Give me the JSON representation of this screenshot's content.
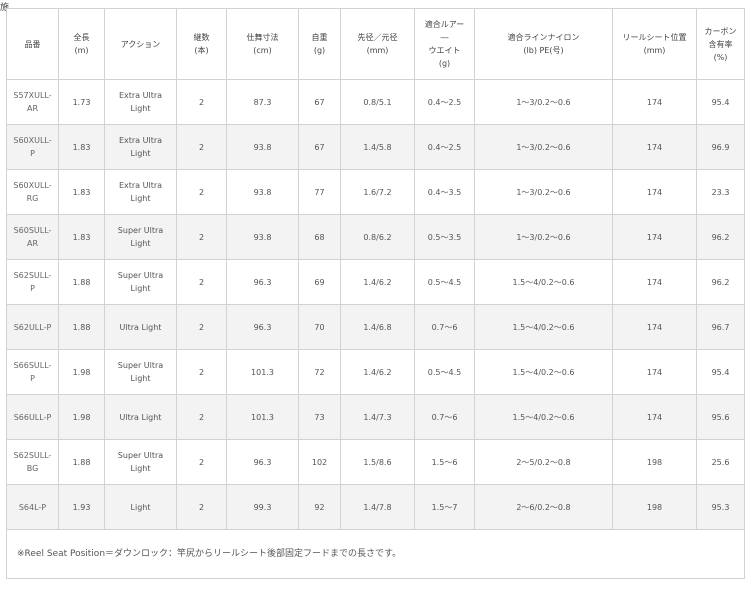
{
  "corner_mark": "施",
  "headers": [
    "品番\n",
    "全長\n(m)",
    "アクション",
    "継数\n(本)",
    "仕舞寸法\n(cm)",
    "自重\n(g)",
    "先径／元径\n(mm)",
    "適合ルアー\n―\nウエイト\n(g)",
    "適合ラインナイロン\n(lb) PE(号)",
    "リールシート位置\n(mm)",
    "カーボン\n含有率\n(%)"
  ],
  "rows": [
    {
      "model": "S57XULL-\nAR",
      "length": "1.73",
      "action": "Extra Ultra\nLight",
      "pieces": "2",
      "closed": "87.3",
      "weight": "67",
      "diameter": "0.8/5.1",
      "lure": "0.4〜2.5",
      "line": "1〜3/0.2〜0.6",
      "seat": "174",
      "carbon": "95.4"
    },
    {
      "model": "S60XULL-\nP",
      "length": "1.83",
      "action": "Extra Ultra\nLight",
      "pieces": "2",
      "closed": "93.8",
      "weight": "67",
      "diameter": "1.4/5.8",
      "lure": "0.4〜2.5",
      "line": "1〜3/0.2〜0.6",
      "seat": "174",
      "carbon": "96.9"
    },
    {
      "model": "S60XULL-\nRG",
      "length": "1.83",
      "action": "Extra Ultra\nLight",
      "pieces": "2",
      "closed": "93.8",
      "weight": "77",
      "diameter": "1.6/7.2",
      "lure": "0.4〜3.5",
      "line": "1〜3/0.2〜0.6",
      "seat": "174",
      "carbon": "23.3"
    },
    {
      "model": "S60SULL-\nAR",
      "length": "1.83",
      "action": "Super Ultra\nLight",
      "pieces": "2",
      "closed": "93.8",
      "weight": "68",
      "diameter": "0.8/6.2",
      "lure": "0.5〜3.5",
      "line": "1〜3/0.2〜0.6",
      "seat": "174",
      "carbon": "96.2"
    },
    {
      "model": "S62SULL-\nP",
      "length": "1.88",
      "action": "Super Ultra\nLight",
      "pieces": "2",
      "closed": "96.3",
      "weight": "69",
      "diameter": "1.4/6.2",
      "lure": "0.5〜4.5",
      "line": "1.5〜4/0.2〜0.6",
      "seat": "174",
      "carbon": "96.2"
    },
    {
      "model": "S62ULL-P",
      "length": "1.88",
      "action": "Ultra Light",
      "pieces": "2",
      "closed": "96.3",
      "weight": "70",
      "diameter": "1.4/6.8",
      "lure": "0.7〜6",
      "line": "1.5〜4/0.2〜0.6",
      "seat": "174",
      "carbon": "96.7"
    },
    {
      "model": "S66SULL-\nP",
      "length": "1.98",
      "action": "Super Ultra\nLight",
      "pieces": "2",
      "closed": "101.3",
      "weight": "72",
      "diameter": "1.4/6.2",
      "lure": "0.5〜4.5",
      "line": "1.5〜4/0.2〜0.6",
      "seat": "174",
      "carbon": "95.4"
    },
    {
      "model": "S66ULL-P",
      "length": "1.98",
      "action": "Ultra Light",
      "pieces": "2",
      "closed": "101.3",
      "weight": "73",
      "diameter": "1.4/7.3",
      "lure": "0.7〜6",
      "line": "1.5〜4/0.2〜0.6",
      "seat": "174",
      "carbon": "95.6"
    },
    {
      "model": "S62SULL-\nBG",
      "length": "1.88",
      "action": "Super Ultra\nLight",
      "pieces": "2",
      "closed": "96.3",
      "weight": "102",
      "diameter": "1.5/8.6",
      "lure": "1.5〜6",
      "line": "2〜5/0.2〜0.8",
      "seat": "198",
      "carbon": "25.6"
    },
    {
      "model": "S64L-P",
      "length": "1.93",
      "action": "Light",
      "pieces": "2",
      "closed": "99.3",
      "weight": "92",
      "diameter": "1.4/7.8",
      "lure": "1.5〜7",
      "line": "2〜6/0.2〜0.8",
      "seat": "198",
      "carbon": "95.3"
    }
  ],
  "note": "※Reel Seat Position＝ダウンロック：竿尻からリールシート後部固定フードまでの長さです。",
  "colors": {
    "border": "#d2d2d2",
    "alt_row": "#f3f3f3",
    "text": "#555555"
  }
}
